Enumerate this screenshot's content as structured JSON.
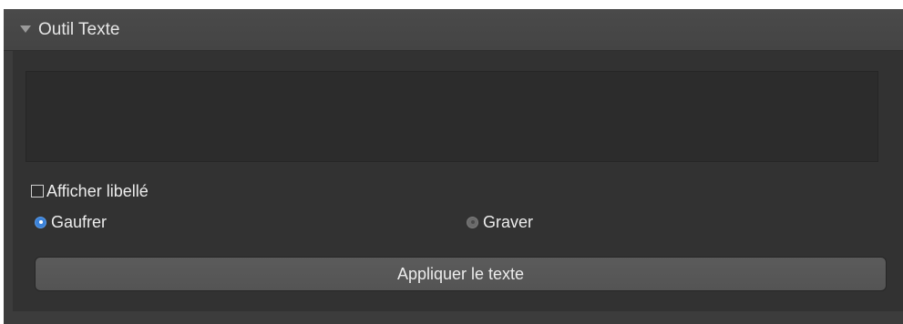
{
  "panel": {
    "title": "Outil Texte",
    "text_input": {
      "value": "",
      "placeholder": ""
    },
    "show_label_checkbox": {
      "label": "Afficher libellé",
      "checked": false
    },
    "mode_options": [
      {
        "label": "Gaufrer",
        "selected": true
      },
      {
        "label": "Graver",
        "selected": false
      }
    ],
    "apply_button_label": "Appliquer le texte"
  },
  "colors": {
    "panel_background": "#3c3c3c",
    "body_background": "#323232",
    "radio_selected": "#3b82d9",
    "text": "#ececec"
  },
  "icons": {
    "header_disclosure": "disclosure-triangle-down"
  }
}
